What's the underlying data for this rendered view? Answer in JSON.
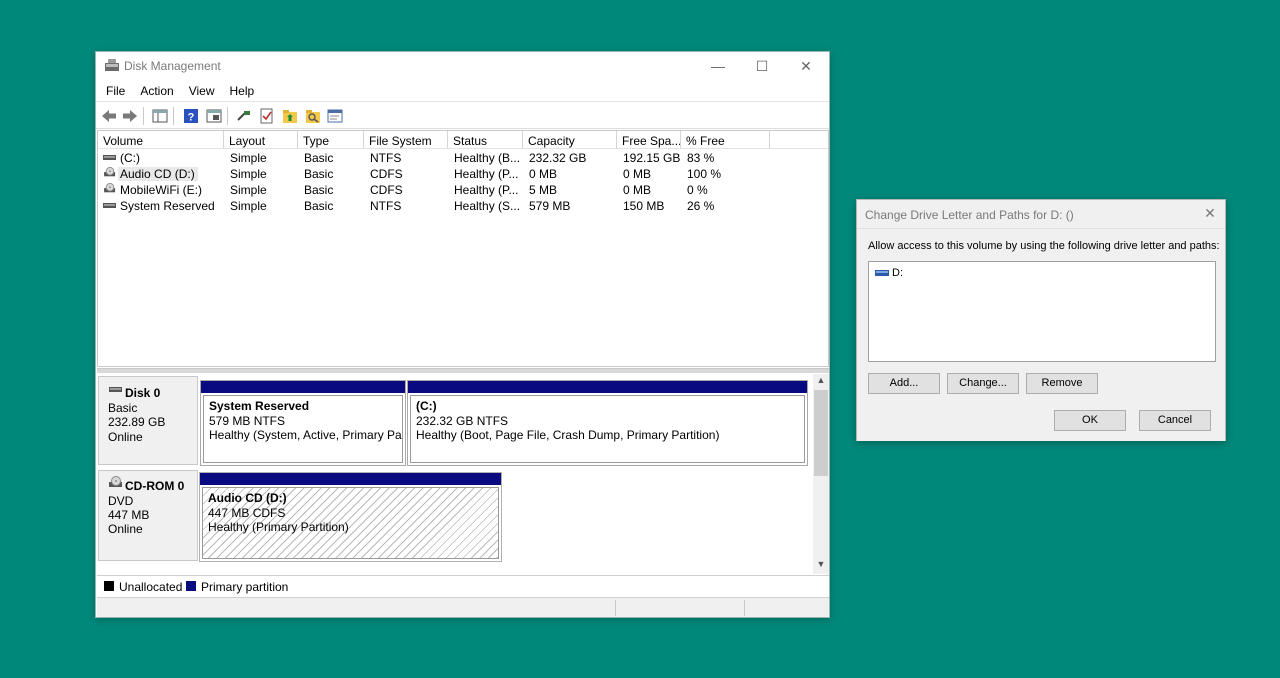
{
  "window": {
    "title": "Disk Management",
    "min_glyph": "—",
    "max_glyph": "☐",
    "close_glyph": "✕"
  },
  "menu": [
    "File",
    "Action",
    "View",
    "Help"
  ],
  "toolbar_icons": [
    "back-arrow-icon",
    "forward-arrow-icon",
    "properties-icon",
    "help-icon",
    "view-panel-icon",
    "connect-icon",
    "checklist-icon",
    "up-folder-icon",
    "search-folder-icon",
    "console-icon"
  ],
  "volume_table": {
    "columns": [
      "Volume",
      "Layout",
      "Type",
      "File System",
      "Status",
      "Capacity",
      "Free Spa...",
      "% Free"
    ],
    "rows": [
      {
        "icon": "drive-icon",
        "volume": "(C:)",
        "layout": "Simple",
        "type": "Basic",
        "fs": "NTFS",
        "status": "Healthy (B...",
        "capacity": "232.32 GB",
        "free": "192.15 GB",
        "pct": "83 %"
      },
      {
        "icon": "cd-drive-icon",
        "volume": "Audio CD (D:)",
        "layout": "Simple",
        "type": "Basic",
        "fs": "CDFS",
        "status": "Healthy (P...",
        "capacity": "0 MB",
        "free": "0 MB",
        "pct": "100 %"
      },
      {
        "icon": "cd-drive-icon",
        "volume": "MobileWiFi (E:)",
        "layout": "Simple",
        "type": "Basic",
        "fs": "CDFS",
        "status": "Healthy (P...",
        "capacity": "5 MB",
        "free": "0 MB",
        "pct": "0 %"
      },
      {
        "icon": "drive-icon",
        "volume": "System Reserved",
        "layout": "Simple",
        "type": "Basic",
        "fs": "NTFS",
        "status": "Healthy (S...",
        "capacity": "579 MB",
        "free": "150 MB",
        "pct": "26 %"
      }
    ]
  },
  "disks": [
    {
      "name": "Disk 0",
      "type": "Basic",
      "size": "232.89 GB",
      "state": "Online",
      "partitions": [
        {
          "title": "System Reserved",
          "size_fs": "579 MB NTFS",
          "status": "Healthy (System, Active, Primary Part"
        },
        {
          "title": "(C:)",
          "size_fs": "232.32 GB NTFS",
          "status": "Healthy (Boot, Page File, Crash Dump, Primary Partition)"
        }
      ]
    },
    {
      "name": "CD-ROM 0",
      "type": "DVD",
      "size": "447 MB",
      "state": "Online",
      "partitions": [
        {
          "title": "Audio CD  (D:)",
          "size_fs": "447 MB CDFS",
          "status": "Healthy (Primary Partition)"
        }
      ]
    }
  ],
  "legend": [
    {
      "label": "Unallocated",
      "color": "#000000"
    },
    {
      "label": "Primary partition",
      "color": "#0a0a80"
    }
  ],
  "dialog": {
    "title": "Change Drive Letter and Paths for D: ()",
    "close_glyph": "✕",
    "description": "Allow access to this volume by using the following drive letter and paths:",
    "entries": [
      "D:"
    ],
    "add_label": "Add...",
    "change_label": "Change...",
    "remove_label": "Remove",
    "ok_label": "OK",
    "cancel_label": "Cancel"
  },
  "colors": {
    "desktop": "#00897B",
    "primary_partition": "#0a0a80"
  }
}
